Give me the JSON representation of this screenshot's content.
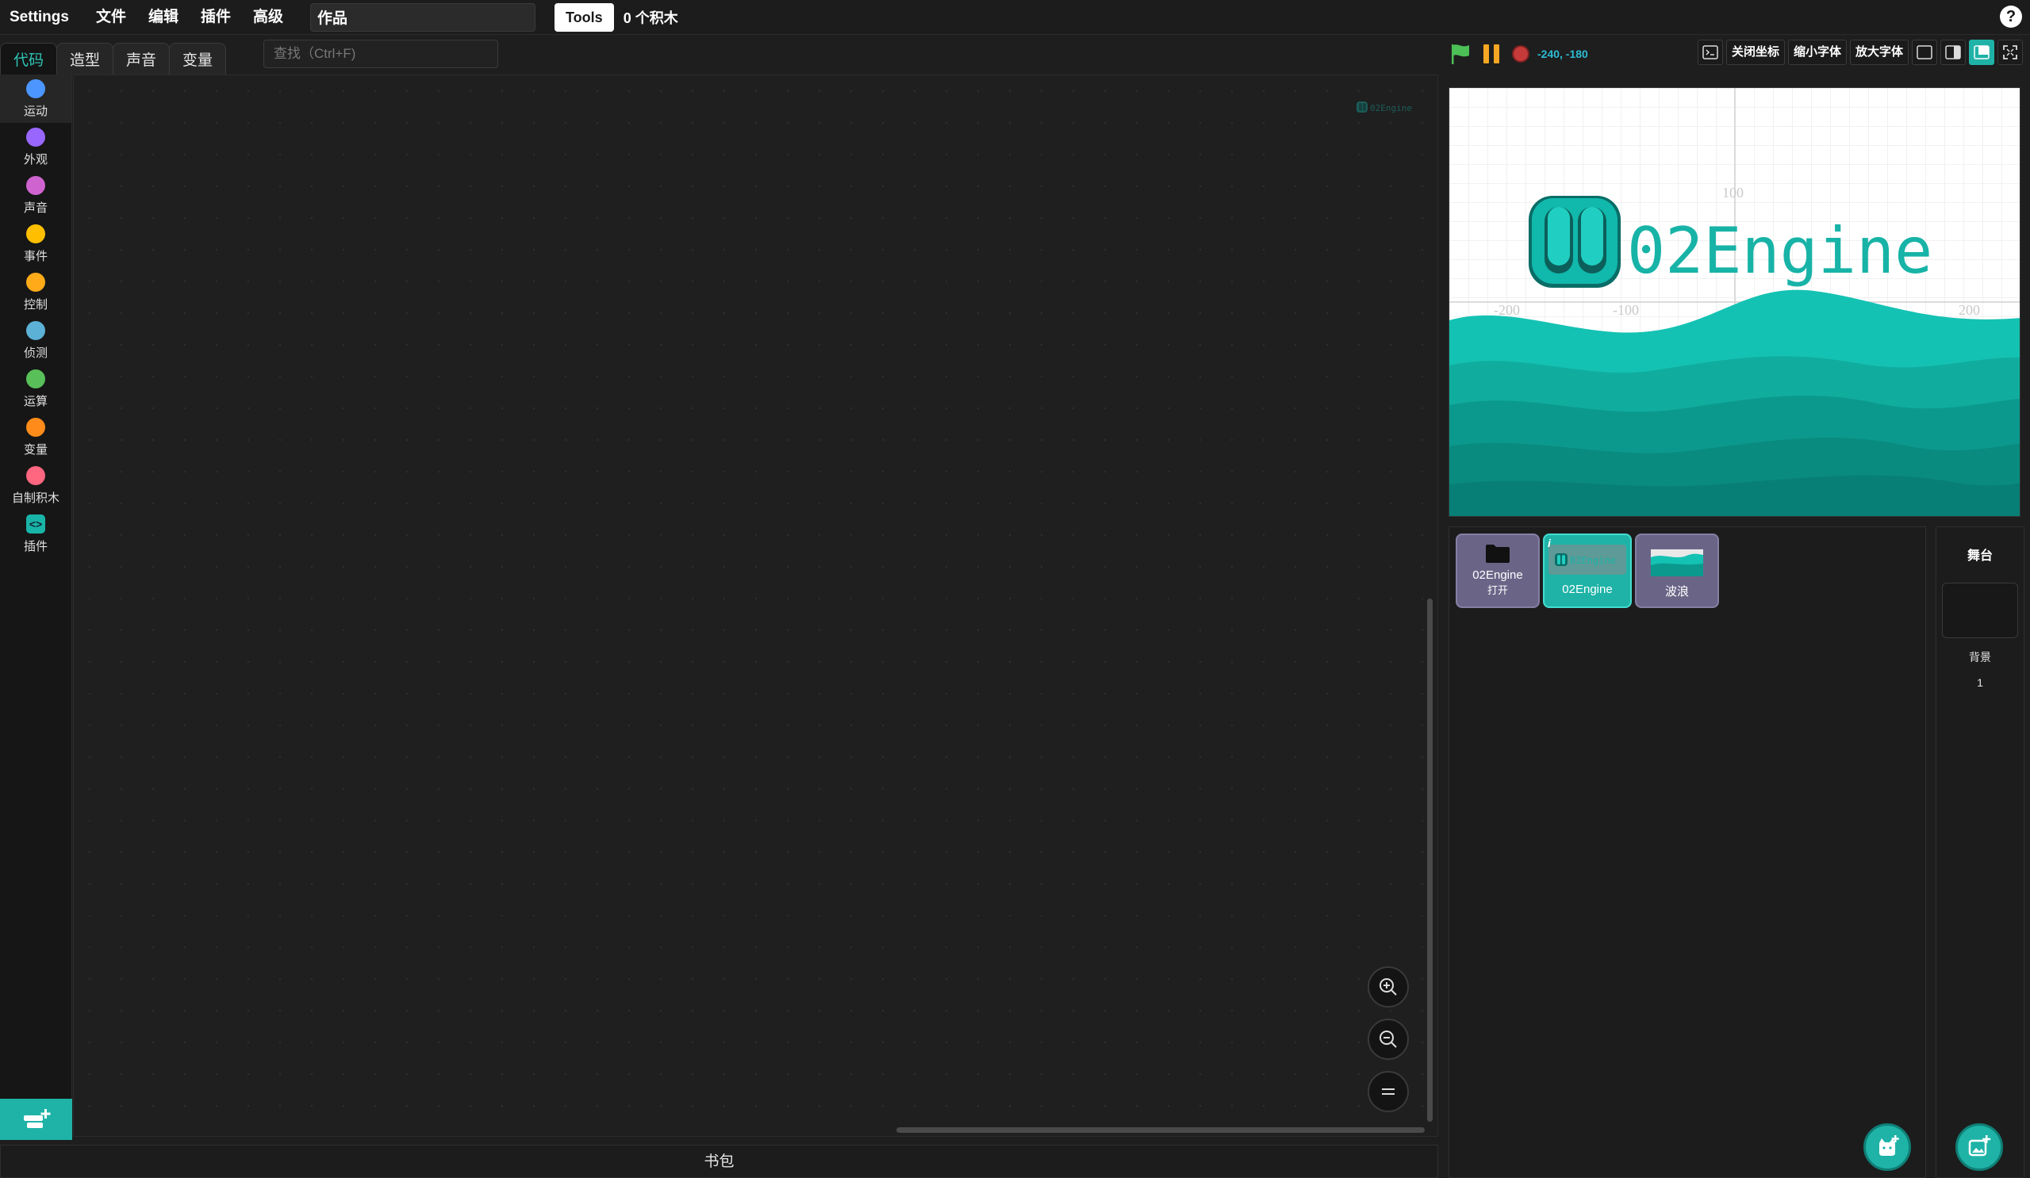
{
  "menubar": {
    "settings": "Settings",
    "items": [
      "文件",
      "编辑",
      "插件",
      "高级"
    ],
    "project_title": "作品",
    "tools": "Tools",
    "block_count": "0 个积木",
    "help": "?"
  },
  "tabs": [
    {
      "label": "代码",
      "active": true
    },
    {
      "label": "造型",
      "active": false
    },
    {
      "label": "声音",
      "active": false
    },
    {
      "label": "变量",
      "active": false
    }
  ],
  "search": {
    "placeholder": "查找（Ctrl+F)"
  },
  "categories": [
    {
      "label": "运动",
      "color": "#4c97ff"
    },
    {
      "label": "外观",
      "color": "#9966ff"
    },
    {
      "label": "声音",
      "color": "#cf63cf"
    },
    {
      "label": "事件",
      "color": "#ffbf00"
    },
    {
      "label": "控制",
      "color": "#ffab19"
    },
    {
      "label": "侦测",
      "color": "#5cb1d6"
    },
    {
      "label": "运算",
      "color": "#59c059"
    },
    {
      "label": "变量",
      "color": "#ff8c1a"
    },
    {
      "label": "自制积木",
      "color": "#ff6680"
    },
    {
      "label": "插件",
      "color": "#19b4a8",
      "icon": "code-brackets-icon"
    }
  ],
  "workspace": {
    "watermark_icon": "02engine-logo-icon"
  },
  "backpack": {
    "label": "书包"
  },
  "stage_header": {
    "coords": "-240, -180",
    "toggle_coords": "关闭坐标",
    "smaller_font": "缩小字体",
    "larger_font": "放大字体"
  },
  "stage": {
    "logo_text": "02Engine",
    "axis_labels": [
      "100",
      "-200",
      "-100",
      "100",
      "200"
    ],
    "colors": {
      "accent": "#1fb3a7",
      "wave_light": "#0fc0b2",
      "wave_dark": "#087f78"
    }
  },
  "sprites": [
    {
      "name": "02Engine",
      "sub": "打开",
      "icon": "folder-icon",
      "selected": false
    },
    {
      "name": "02Engine",
      "sub": "",
      "icon": "02engine-logo-icon",
      "selected": true
    },
    {
      "name": "波浪",
      "sub": "",
      "icon": "wave-thumbnail",
      "selected": false
    }
  ],
  "target": {
    "title": "舞台",
    "backdrop_label": "背景",
    "backdrop_count": "1"
  },
  "colors": {
    "accent": "#1fb3a7",
    "background": "#1e1e1e"
  }
}
